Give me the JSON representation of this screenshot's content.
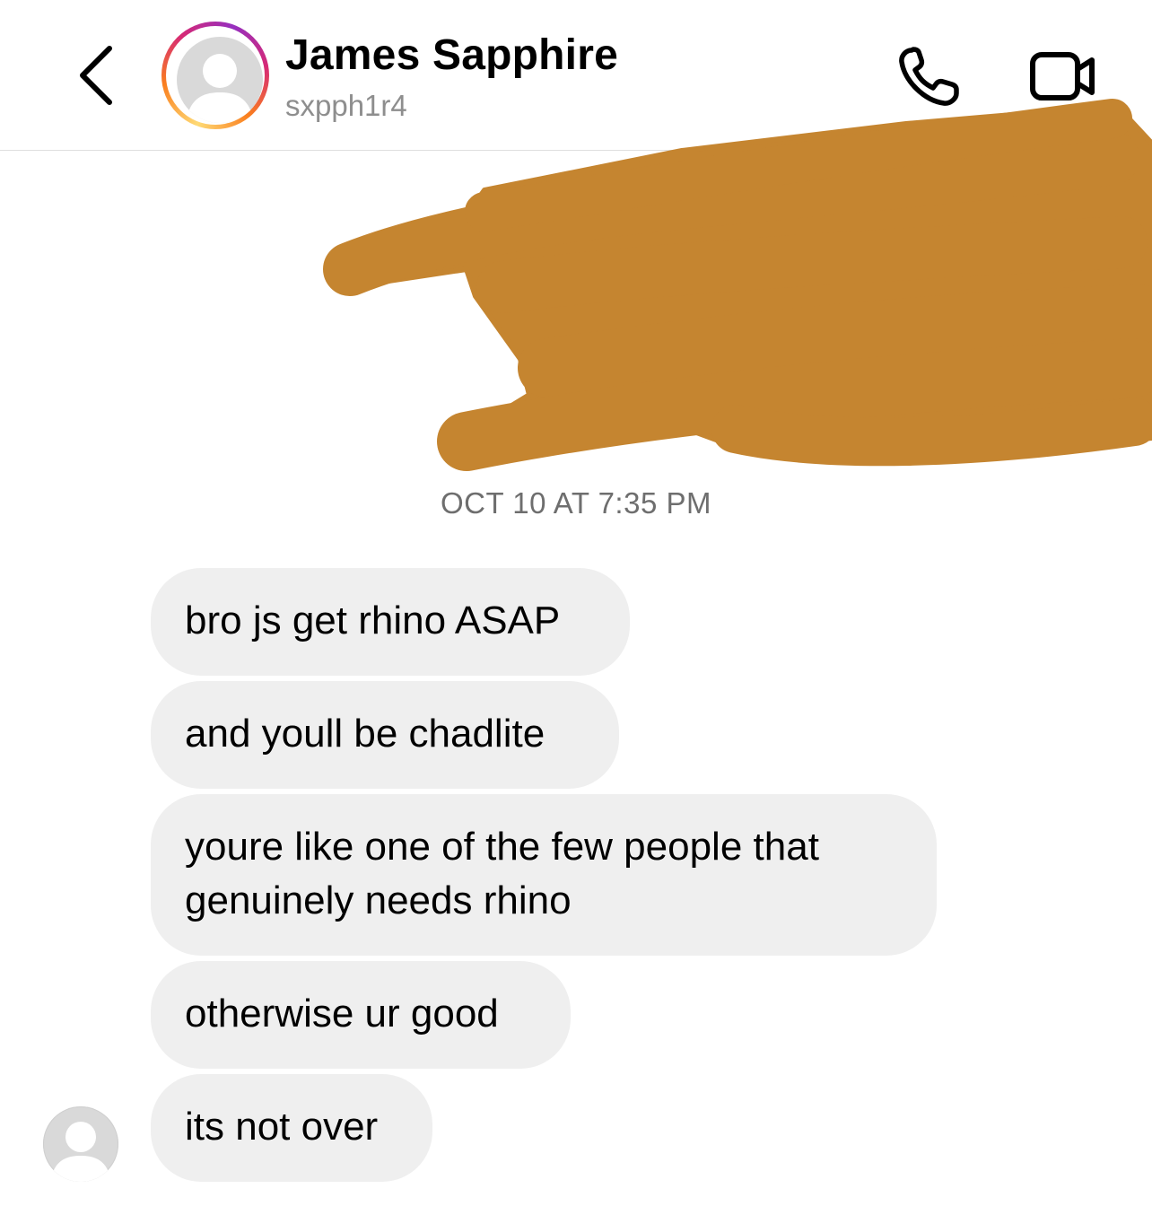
{
  "header": {
    "contact_name": "James Sapphire",
    "username": "sxpph1r4",
    "back_icon": "chevron-left-icon",
    "call_icon": "phone-icon",
    "video_icon": "video-camera-icon",
    "story_ring_colors": [
      "#feda75",
      "#fa7e1e",
      "#d62976",
      "#962fbf"
    ]
  },
  "conversation": {
    "timestamp": "OCT 10 AT 7:35 PM",
    "messages": [
      {
        "text": "bro js get rhino ASAP"
      },
      {
        "text": "and youll be chadlite"
      },
      {
        "text": "youre like one of the few people that genuinely needs rhino"
      },
      {
        "text": "otherwise ur good"
      },
      {
        "text": "its not over"
      }
    ]
  },
  "colors": {
    "bubble_background": "#efefef",
    "redaction_scribble": "#c58530",
    "timestamp_text": "#6e6e6e",
    "username_text": "#8e8e8e"
  }
}
